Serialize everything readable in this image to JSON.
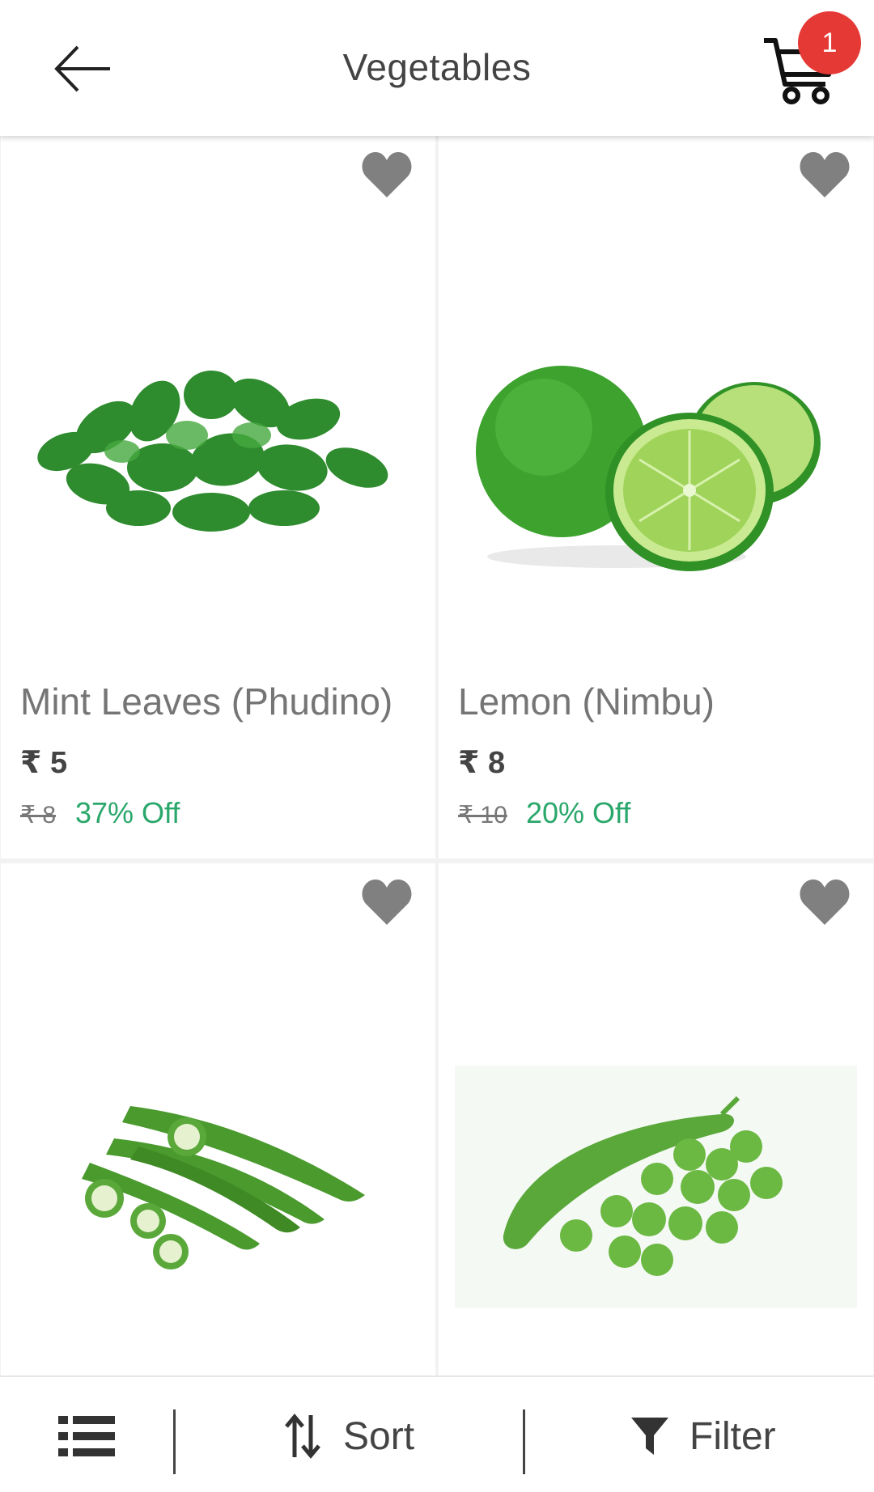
{
  "header": {
    "title": "Vegetables",
    "cart_count": "1"
  },
  "products": [
    {
      "name": "Mint Leaves (Phudino)",
      "price": "₹ 5",
      "mrp": "₹ 8",
      "discount": "37% Off",
      "image": "mint-leaves"
    },
    {
      "name": "Lemon (Nimbu)",
      "price": "₹ 8",
      "mrp": "₹ 10",
      "discount": "20% Off",
      "image": "lemon"
    },
    {
      "name": "",
      "price": "",
      "mrp": "",
      "discount": "",
      "image": "okra"
    },
    {
      "name": "",
      "price": "",
      "mrp": "",
      "discount": "",
      "image": "green-peas"
    }
  ],
  "bottom_bar": {
    "sort_label": "Sort",
    "filter_label": "Filter"
  },
  "colors": {
    "badge": "#e53935",
    "discount": "#2aa76b",
    "heart": "#808080",
    "text": "#444444"
  },
  "icons": [
    "back-arrow-icon",
    "cart-icon",
    "heart-icon",
    "list-view-icon",
    "sort-icon",
    "filter-icon"
  ]
}
